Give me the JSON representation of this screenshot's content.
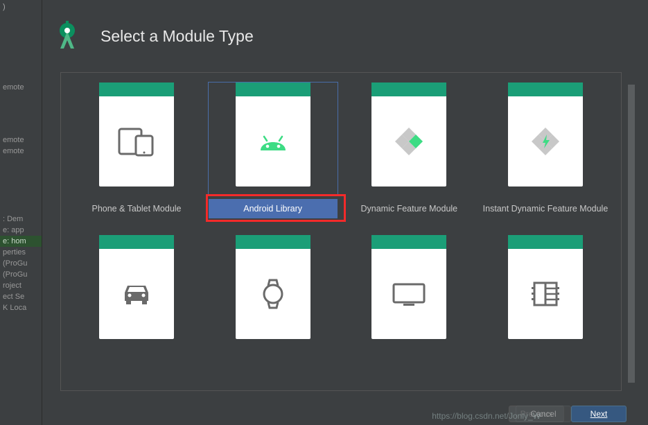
{
  "breadcrumb": ")",
  "sidebar_fragments": {
    "a": "emote",
    "b": "emote",
    "c": "emote",
    "d": ": Dem",
    "e": "e: app",
    "f": "e: hom",
    "g": "perties",
    "h": "(ProGu",
    "i": "(ProGu",
    "j": "roject",
    "k": "ect Se",
    "l": "K Loca"
  },
  "header": {
    "title": "Select a Module Type"
  },
  "modules": [
    {
      "label": "Phone & Tablet Module",
      "icon": "phone-tablet"
    },
    {
      "label": "Android Library",
      "icon": "android",
      "selected": true
    },
    {
      "label": "Dynamic Feature Module",
      "icon": "dynamic"
    },
    {
      "label": "Instant Dynamic Feature Module",
      "icon": "instant"
    },
    {
      "label": "",
      "icon": "car"
    },
    {
      "label": "",
      "icon": "wear"
    },
    {
      "label": "",
      "icon": "tv"
    },
    {
      "label": "",
      "icon": "things"
    }
  ],
  "buttons": {
    "previous": "Previous",
    "next": "Next",
    "cancel": "Cancel"
  },
  "watermark": "https://blog.csdn.net/Jonly_W"
}
